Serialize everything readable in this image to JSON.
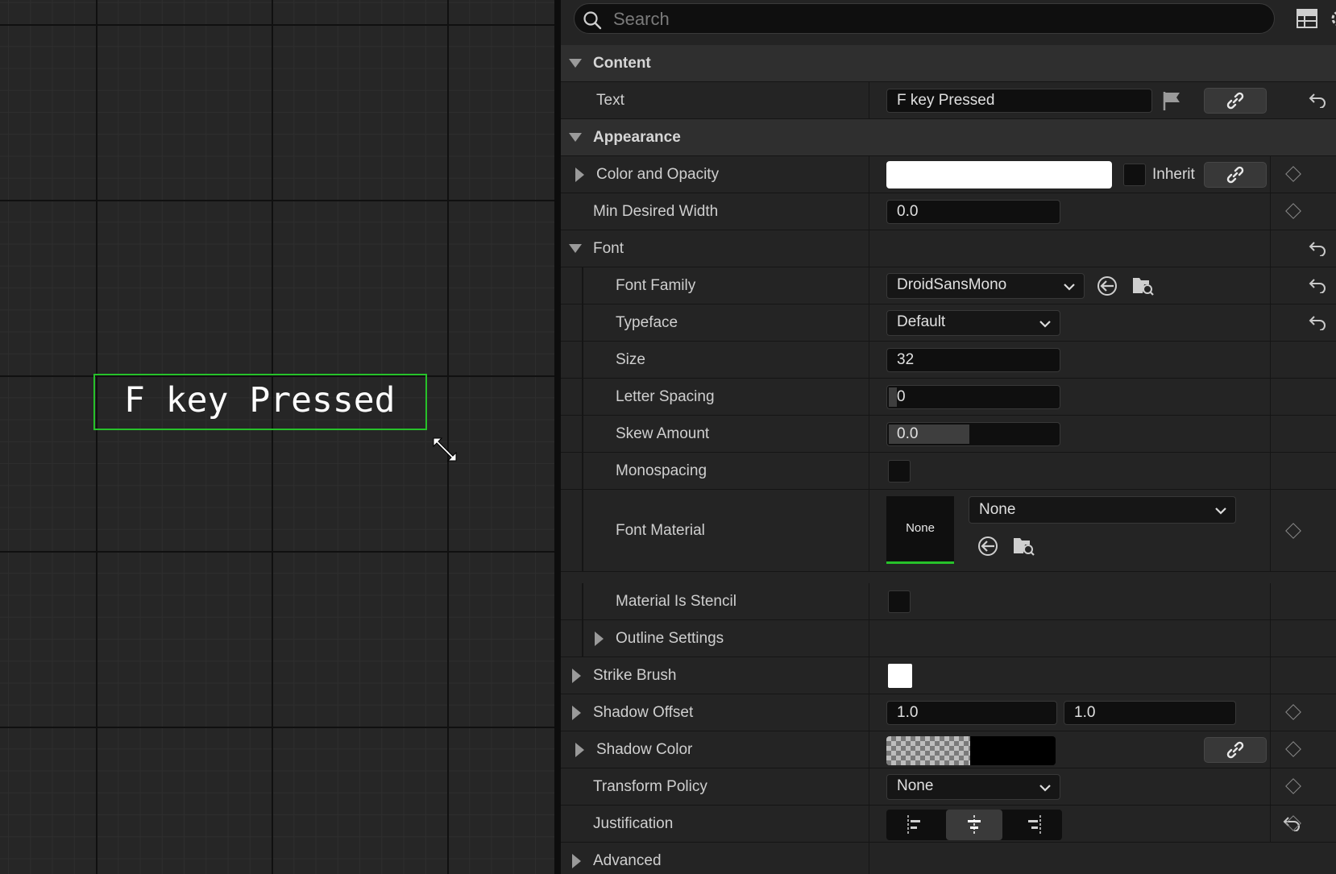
{
  "canvas": {
    "text_widget_label": "F key Pressed"
  },
  "search": {
    "placeholder": "Search",
    "value": ""
  },
  "categories": {
    "content": "Content",
    "appearance": "Appearance"
  },
  "properties": {
    "text": {
      "label": "Text",
      "value": "F key Pressed"
    },
    "color_opacity": {
      "label": "Color and Opacity",
      "swatch": "#ffffff",
      "inherit_label": "Inherit"
    },
    "min_width": {
      "label": "Min Desired Width",
      "value": "0.0"
    },
    "font": {
      "label": "Font"
    },
    "font_family": {
      "label": "Font Family",
      "value": "DroidSansMono"
    },
    "typeface": {
      "label": "Typeface",
      "value": "Default"
    },
    "size": {
      "label": "Size",
      "value": "32"
    },
    "letter_spacing": {
      "label": "Letter Spacing",
      "value": "0"
    },
    "skew_amount": {
      "label": "Skew Amount",
      "value": "0.0"
    },
    "monospacing": {
      "label": "Monospacing"
    },
    "font_material": {
      "label": "Font Material",
      "thumb": "None",
      "value": "None"
    },
    "material_stencil": {
      "label": "Material Is Stencil"
    },
    "outline_settings": {
      "label": "Outline Settings"
    },
    "strike_brush": {
      "label": "Strike Brush",
      "swatch": "#ffffff"
    },
    "shadow_offset": {
      "label": "Shadow Offset",
      "x": "1.0",
      "y": "1.0"
    },
    "shadow_color": {
      "label": "Shadow Color",
      "swatch": "#000000"
    },
    "transform_policy": {
      "label": "Transform Policy",
      "value": "None"
    },
    "justification": {
      "label": "Justification",
      "selected": "center"
    },
    "advanced": {
      "label": "Advanced"
    }
  },
  "colors": {
    "accent_green": "#27c12a",
    "panel_bg": "#242424",
    "category_bg": "#2f2f2f",
    "field_bg": "#0f0f0f"
  }
}
